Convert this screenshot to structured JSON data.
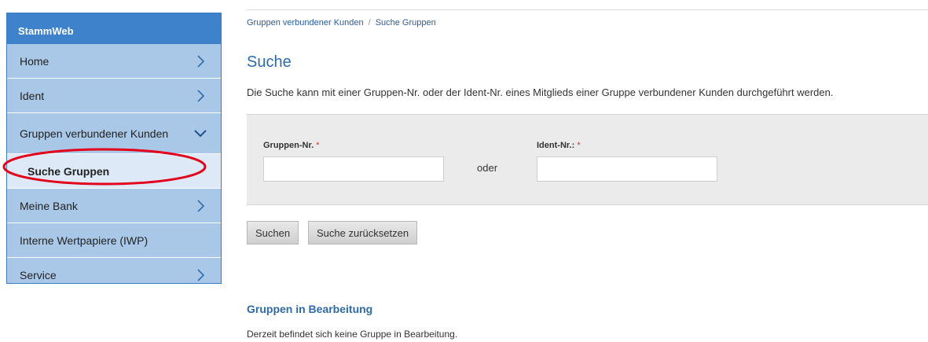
{
  "sidebar": {
    "title": "StammWeb",
    "items": [
      {
        "label": "Home"
      },
      {
        "label": "Ident"
      },
      {
        "label": "Gruppen verbundener Kunden"
      },
      {
        "label": "Suche Gruppen"
      },
      {
        "label": "Meine Bank"
      },
      {
        "label": "Interne Wertpapiere (IWP)"
      },
      {
        "label": "Service"
      }
    ]
  },
  "breadcrumb": {
    "parent": "Gruppen verbundener Kunden",
    "separator": "/",
    "current": "Suche Gruppen"
  },
  "main": {
    "title": "Suche",
    "intro": "Die Suche kann mit einer Gruppen-Nr. oder der Ident-Nr. eines Mitglieds einer Gruppe verbundener Kunden durchgeführt werden.",
    "form": {
      "gruppen_label": "Gruppen-Nr.",
      "ident_label": "Ident-Nr.:",
      "required_mark": "*",
      "oder": "oder",
      "gruppen_value": "",
      "ident_value": ""
    },
    "buttons": {
      "search": "Suchen",
      "reset": "Suche zurücksetzen"
    },
    "section": {
      "title": "Gruppen in Bearbeitung",
      "text": "Derzeit befindet sich keine Gruppe in Bearbeitung."
    }
  },
  "colors": {
    "sidebar_header": "#3f82cc",
    "sidebar_item": "#a9c8e8",
    "highlight_circle": "#e3001b",
    "link": "#2a5d9f"
  },
  "icons": {
    "chevron_right": "chevron-right-icon",
    "chevron_down": "chevron-down-icon"
  }
}
